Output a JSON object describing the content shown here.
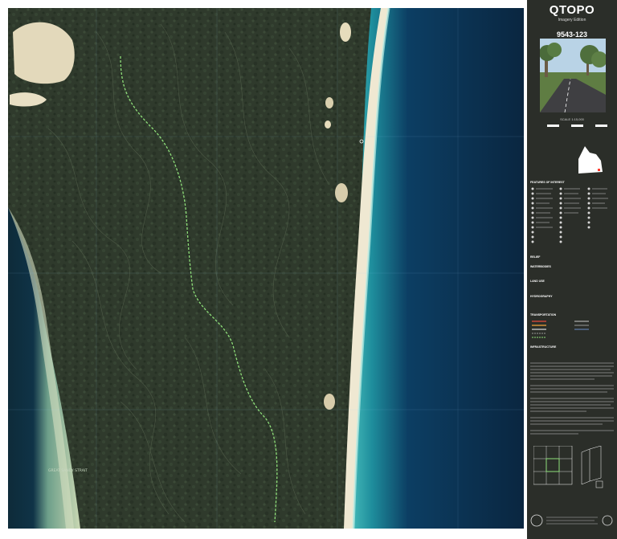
{
  "panel": {
    "title": "QTOPO",
    "subtitle": "Imagery Edition",
    "map_number": "9543-123",
    "scale": "SCALE 1:15,000",
    "legend_headings": [
      "FEATURES OF INTEREST",
      "RELIEF",
      "WATERBODIES",
      "LAND USE",
      "HYDROGRAPHY",
      "TRANSPORTATION",
      "INFRASTRUCTURE"
    ]
  },
  "map": {
    "label": "GREAT SANDY STRAIT"
  },
  "colors": {
    "forest": "#2f3a2c",
    "sand": "#e8e2c8",
    "ocean_deep": "#0b2a44",
    "ocean_shallow": "#2a9a9e",
    "panel": "#2b2e29",
    "track": "#8fe07a"
  }
}
